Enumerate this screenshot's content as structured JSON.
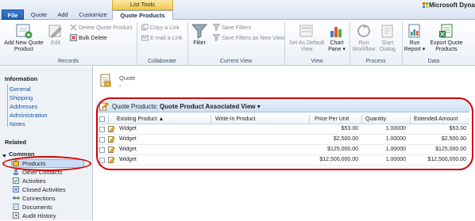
{
  "brand": "Microsoft Dyna",
  "tabs": {
    "contextual_group": "List Tools",
    "file": "File",
    "quote": "Quote",
    "add": "Add",
    "customize": "Customize",
    "quote_products": "Quote Products"
  },
  "ribbon": {
    "records": {
      "label": "Records",
      "add_new_line1": "Add New Quote",
      "add_new_line2": "Product",
      "edit": "Edit",
      "delete": "Delete Quote Product",
      "bulk_delete": "Bulk Delete"
    },
    "collaborate": {
      "label": "Collaborate",
      "copy_link": "Copy a Link",
      "email_link": "E-mail a Link"
    },
    "current_view": {
      "label": "Current View",
      "filter": "Filter",
      "save_filters": "Save Filters",
      "save_filters_as": "Save Filters as New View"
    },
    "view": {
      "label": "View",
      "set_default_line1": "Set As Default",
      "set_default_line2": "View",
      "chart_line1": "Chart",
      "chart_line2": "Pane ▾"
    },
    "process": {
      "label": "Process",
      "run_workflow_line1": "Run",
      "run_workflow_line2": "Workflow",
      "start_dialog_line1": "Start",
      "start_dialog_line2": "Dialog"
    },
    "data": {
      "label": "Data",
      "run_report_line1": "Run",
      "run_report_line2": "Report ▾",
      "export_line1": "Export Quote",
      "export_line2": "Products"
    }
  },
  "leftnav": {
    "information_header": "Information",
    "information_items": [
      "General",
      "Shipping",
      "Addresses",
      "Administration",
      "Notes"
    ],
    "related_header": "Related",
    "common_header": "Common",
    "common_items": [
      "Products",
      "Other Contacts",
      "Activities",
      "Closed Activities",
      "Connections",
      "Documents",
      "Audit History"
    ]
  },
  "main": {
    "entity": "Quote",
    "record_name": "-",
    "grid_entity": "Quote Products:",
    "view_name": "Quote Product Associated View",
    "view_dropdown": "▾",
    "columns": [
      "Existing Product ▲",
      "Write-In Product",
      "Price Per Unit",
      "Quantity",
      "Extended Amount"
    ],
    "rows": [
      [
        "Widget",
        "",
        "$53.00",
        "1.00000",
        "$53.00"
      ],
      [
        "Widget",
        "",
        "$2,500.00",
        "1.00000",
        "$2,500.00"
      ],
      [
        "Widget",
        "",
        "$125,000.00",
        "1.00000",
        "$125,000.00"
      ],
      [
        "Widget",
        "",
        "$12,500,000.00",
        "1.00000",
        "$12,500,000.00"
      ]
    ]
  },
  "colors": {
    "highlight": "#d40000",
    "accent": "#1f5fb3",
    "contextual_tab": "#f2c94c"
  }
}
